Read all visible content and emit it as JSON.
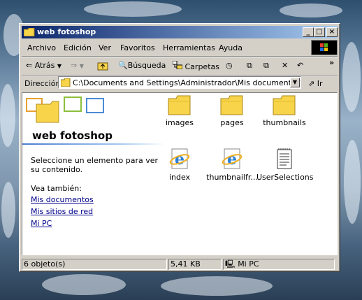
{
  "window": {
    "title": "web fotoshop",
    "buttons": {
      "minimize": "_",
      "maximize": "□",
      "close": "×"
    }
  },
  "menu": [
    "Archivo",
    "Edición",
    "Ver",
    "Favoritos",
    "Herramientas",
    "Ayuda"
  ],
  "toolbar": {
    "back": "Atrás",
    "search": "Búsqueda",
    "folders": "Carpetas",
    "chevron": "»"
  },
  "address": {
    "label": "Dirección",
    "value": "C:\\Documents and Settings\\Administrador\\Mis documentos\\web f",
    "go": "Ir"
  },
  "left_panel": {
    "folder_title": "web fotoshop",
    "description": "Seleccione un elemento para ver su contenido.",
    "see_also": "Vea también:",
    "links": [
      "Mis documentos",
      "Mis sitios de red",
      "Mi PC"
    ]
  },
  "items": [
    {
      "name": "images",
      "icon": "folder-icon"
    },
    {
      "name": "pages",
      "icon": "folder-icon"
    },
    {
      "name": "thumbnails",
      "icon": "folder-icon"
    },
    {
      "name": "index",
      "icon": "ie-document-icon"
    },
    {
      "name": "thumbnailfr...",
      "icon": "ie-document-icon"
    },
    {
      "name": "UserSelections",
      "icon": "text-document-icon"
    }
  ],
  "status": {
    "count": "6 objeto(s)",
    "size": "5,41 KB",
    "location": "Mi PC"
  },
  "colors": {
    "titlebar_start": "#0a246a",
    "titlebar_end": "#a6caf0",
    "face": "#d4d0c8",
    "link": "#00008b"
  }
}
